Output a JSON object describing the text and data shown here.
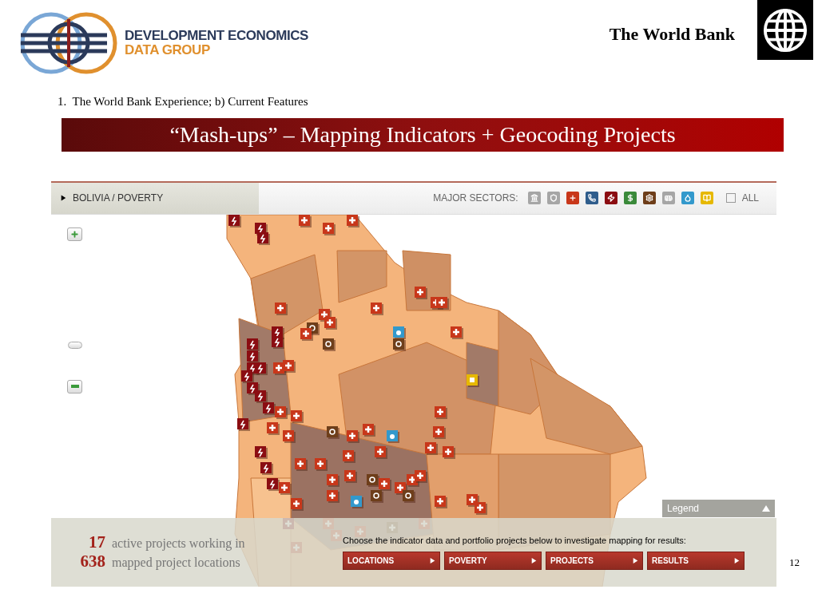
{
  "header": {
    "logo_line1": "DEVELOPMENT ECONOMICS",
    "logo_line2": "DATA GROUP",
    "organization": "The World Bank"
  },
  "subtitle": "1.  The World Bank Experience; b) Current Features",
  "title": "“Mash-ups” – Mapping Indicators + Geocoding Projects",
  "map_app": {
    "breadcrumb": "BOLIVIA / POVERTY",
    "sectors_label": "MAJOR SECTORS:",
    "sectors": [
      {
        "kind": "bank",
        "color": "#a6a6a6"
      },
      {
        "kind": "shield",
        "color": "#a6a6a6"
      },
      {
        "kind": "health",
        "color": "#c8371a"
      },
      {
        "kind": "phone",
        "color": "#2f5d8c"
      },
      {
        "kind": "energy",
        "color": "#8b0d12"
      },
      {
        "kind": "finance",
        "color": "#3a8a3a"
      },
      {
        "kind": "gear",
        "color": "#6e3e1a"
      },
      {
        "kind": "transport",
        "color": "#a6a6a6"
      },
      {
        "kind": "water",
        "color": "#3399cc"
      },
      {
        "kind": "education",
        "color": "#e6b800"
      }
    ],
    "all": {
      "label": "ALL",
      "checked": false
    },
    "legend": "Legend",
    "stats": [
      {
        "number": "17",
        "text": "active projects working in"
      },
      {
        "number": "638",
        "text": "mapped project locations"
      }
    ],
    "instruction": "Choose the indicator data and portfolio projects below to investigate mapping for results:",
    "buttons": [
      "LOCATIONS",
      "POVERTY",
      "PROJECTS",
      "RESULTS"
    ]
  },
  "page_number": "12"
}
